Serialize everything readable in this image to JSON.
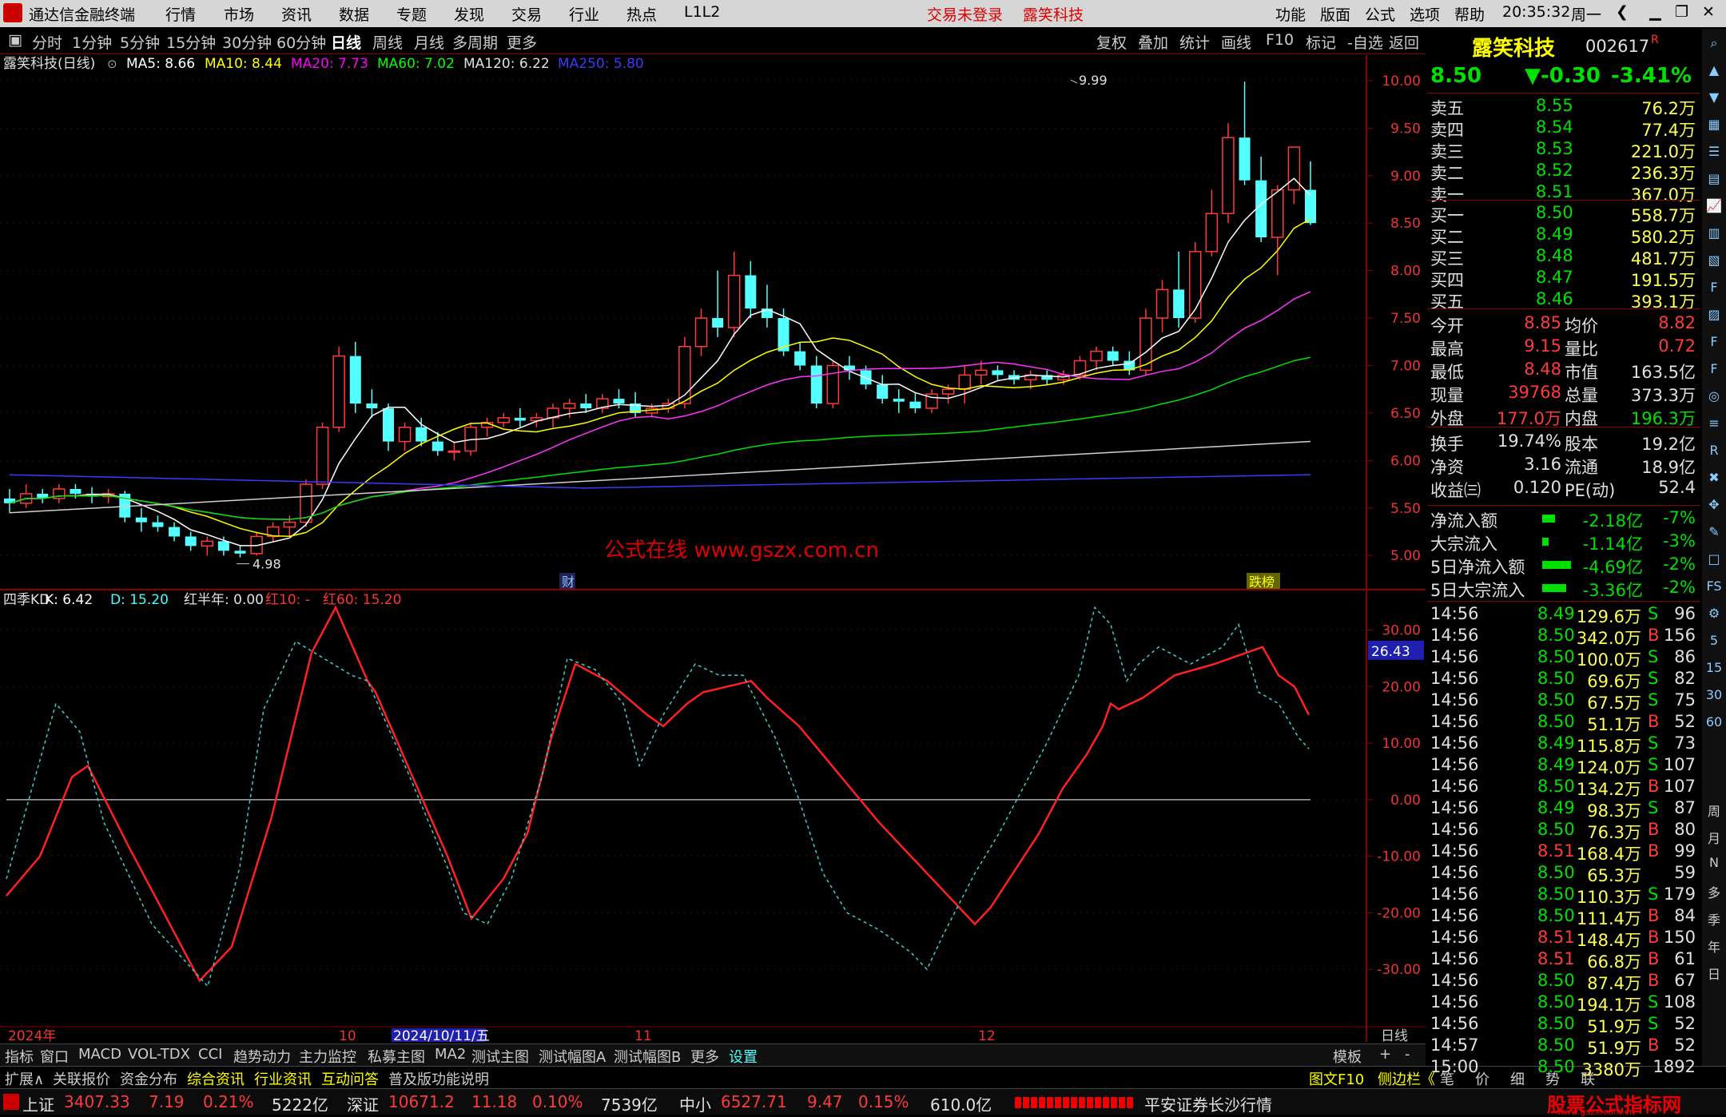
{
  "menubar": {
    "app_title": "通达信金融终端",
    "menus": [
      "行情",
      "市场",
      "资讯",
      "数据",
      "专题",
      "发现",
      "交易",
      "行业",
      "热点",
      "L1L2"
    ],
    "trade_status": "交易未登录",
    "stock_name": "露笑科技",
    "right_menus": [
      "功能",
      "版面",
      "公式",
      "选项",
      "帮助"
    ],
    "clock": "20:35:32",
    "weekday": "周一"
  },
  "toolbar": {
    "periods": [
      "分时",
      "1分钟",
      "5分钟",
      "15分钟",
      "30分钟",
      "60分钟",
      "日线",
      "周线",
      "月线",
      "多周期",
      "更多"
    ],
    "active": "日线",
    "right_buttons": [
      "复权",
      "叠加",
      "统计",
      "画线",
      "F10",
      "标记",
      "-自选",
      "返回"
    ]
  },
  "main_chart": {
    "header_name": "露笑科技(日线)",
    "ma_legend": [
      {
        "label": "MA5: 8.66",
        "color": "#ffffff"
      },
      {
        "label": "MA10: 8.44",
        "color": "#ffff00"
      },
      {
        "label": "MA20: 7.73",
        "color": "#ff00ff"
      },
      {
        "label": "MA60: 7.02",
        "color": "#00ff00"
      },
      {
        "label": "MA120: 6.22",
        "color": "#e0e0e0"
      },
      {
        "label": "MA250: 5.80",
        "color": "#3a3aff"
      }
    ],
    "y_ticks": [
      "10.00",
      "9.50",
      "9.00",
      "8.50",
      "8.00",
      "7.50",
      "7.00",
      "6.50",
      "6.00",
      "5.50",
      "5.00"
    ],
    "y_range": [
      4.8,
      10.1
    ],
    "high_label": "9.99",
    "low_label": "4.98",
    "watermark": "公式在线 www.gszx.com.cn",
    "marker_cai": "财",
    "marker_diebang": "跌榜"
  },
  "indicator": {
    "header_name": "四季KD",
    "k_label": "K: 6.42",
    "d_label": "D: 15.20",
    "hong_label": "红半年: 0.00",
    "hong10_label": "红10: -",
    "hong60_label": "红60: 15.20",
    "y_ticks": [
      "30.00",
      "20.00",
      "10.00",
      "0.00",
      "-10.00",
      "-20.00",
      "-30.00"
    ],
    "y_range": [
      -40,
      37
    ],
    "current_value": "26.43"
  },
  "time_axis": {
    "labels": [
      "2024年",
      "10",
      "2024/10/11/五",
      "11",
      "12"
    ],
    "period_label": "日线"
  },
  "chart_data": {
    "type": "candlestick",
    "candles": [
      [
        5.6,
        5.7,
        5.45,
        5.55
      ],
      [
        5.55,
        5.75,
        5.5,
        5.65
      ],
      [
        5.65,
        5.7,
        5.55,
        5.6
      ],
      [
        5.6,
        5.75,
        5.55,
        5.7
      ],
      [
        5.7,
        5.75,
        5.6,
        5.65
      ],
      [
        5.65,
        5.72,
        5.55,
        5.62
      ],
      [
        5.62,
        5.7,
        5.55,
        5.65
      ],
      [
        5.65,
        5.68,
        5.35,
        5.4
      ],
      [
        5.4,
        5.5,
        5.25,
        5.35
      ],
      [
        5.35,
        5.42,
        5.25,
        5.3
      ],
      [
        5.3,
        5.35,
        5.15,
        5.2
      ],
      [
        5.2,
        5.25,
        5.05,
        5.1
      ],
      [
        5.1,
        5.2,
        5.0,
        5.15
      ],
      [
        5.15,
        5.2,
        5.0,
        5.05
      ],
      [
        5.05,
        5.1,
        4.98,
        5.02
      ],
      [
        5.02,
        5.25,
        5.0,
        5.2
      ],
      [
        5.2,
        5.35,
        5.15,
        5.3
      ],
      [
        5.3,
        5.42,
        5.2,
        5.35
      ],
      [
        5.35,
        5.8,
        5.3,
        5.75
      ],
      [
        5.75,
        6.4,
        5.7,
        6.35
      ],
      [
        6.35,
        7.2,
        6.3,
        7.1
      ],
      [
        7.1,
        7.25,
        6.5,
        6.6
      ],
      [
        6.6,
        6.75,
        6.45,
        6.55
      ],
      [
        6.55,
        6.6,
        6.1,
        6.2
      ],
      [
        6.2,
        6.4,
        6.1,
        6.35
      ],
      [
        6.35,
        6.45,
        6.15,
        6.2
      ],
      [
        6.2,
        6.3,
        6.05,
        6.1
      ],
      [
        6.1,
        6.2,
        6.0,
        6.1
      ],
      [
        6.1,
        6.4,
        6.05,
        6.35
      ],
      [
        6.35,
        6.45,
        6.25,
        6.4
      ],
      [
        6.4,
        6.5,
        6.35,
        6.45
      ],
      [
        6.45,
        6.55,
        6.35,
        6.42
      ],
      [
        6.42,
        6.5,
        6.35,
        6.45
      ],
      [
        6.45,
        6.6,
        6.35,
        6.55
      ],
      [
        6.55,
        6.65,
        6.45,
        6.6
      ],
      [
        6.6,
        6.7,
        6.5,
        6.55
      ],
      [
        6.55,
        6.7,
        6.5,
        6.65
      ],
      [
        6.65,
        6.75,
        6.55,
        6.6
      ],
      [
        6.6,
        6.72,
        6.45,
        6.5
      ],
      [
        6.5,
        6.6,
        6.45,
        6.55
      ],
      [
        6.55,
        6.65,
        6.5,
        6.6
      ],
      [
        6.6,
        7.3,
        6.55,
        7.2
      ],
      [
        7.2,
        7.6,
        7.1,
        7.5
      ],
      [
        7.5,
        8.0,
        7.3,
        7.4
      ],
      [
        7.4,
        8.2,
        7.3,
        7.95
      ],
      [
        7.95,
        8.1,
        7.5,
        7.6
      ],
      [
        7.6,
        7.85,
        7.4,
        7.5
      ],
      [
        7.5,
        7.6,
        7.1,
        7.15
      ],
      [
        7.15,
        7.25,
        6.95,
        7.0
      ],
      [
        7.0,
        7.1,
        6.55,
        6.6
      ],
      [
        6.6,
        7.05,
        6.55,
        7.0
      ],
      [
        7.0,
        7.1,
        6.85,
        6.95
      ],
      [
        6.95,
        7.0,
        6.75,
        6.8
      ],
      [
        6.8,
        6.9,
        6.6,
        6.65
      ],
      [
        6.65,
        6.75,
        6.5,
        6.62
      ],
      [
        6.62,
        6.72,
        6.5,
        6.55
      ],
      [
        6.55,
        6.75,
        6.5,
        6.7
      ],
      [
        6.7,
        6.8,
        6.6,
        6.75
      ],
      [
        6.75,
        7.0,
        6.6,
        6.9
      ],
      [
        6.9,
        7.05,
        6.8,
        6.95
      ],
      [
        6.95,
        7.0,
        6.85,
        6.9
      ],
      [
        6.9,
        6.95,
        6.8,
        6.85
      ],
      [
        6.85,
        6.95,
        6.75,
        6.9
      ],
      [
        6.9,
        6.95,
        6.8,
        6.85
      ],
      [
        6.85,
        6.95,
        6.8,
        6.9
      ],
      [
        6.9,
        7.1,
        6.85,
        7.05
      ],
      [
        7.05,
        7.2,
        6.95,
        7.15
      ],
      [
        7.15,
        7.2,
        7.0,
        7.05
      ],
      [
        7.05,
        7.15,
        6.9,
        6.95
      ],
      [
        6.95,
        7.6,
        6.9,
        7.5
      ],
      [
        7.5,
        7.9,
        7.35,
        7.8
      ],
      [
        7.8,
        8.2,
        7.4,
        7.5
      ],
      [
        7.5,
        8.3,
        7.45,
        8.2
      ],
      [
        8.2,
        8.85,
        8.15,
        8.6
      ],
      [
        8.6,
        9.55,
        8.5,
        9.4
      ],
      [
        9.4,
        9.99,
        8.9,
        8.95
      ],
      [
        8.95,
        9.2,
        8.3,
        8.35
      ],
      [
        8.35,
        8.9,
        7.95,
        8.85
      ],
      [
        8.85,
        9.3,
        8.7,
        9.3
      ],
      [
        8.85,
        9.15,
        8.48,
        8.5
      ]
    ]
  },
  "quote": {
    "name": "露笑科技",
    "code": "002617",
    "badge": "R",
    "price": "8.50",
    "change": "▼-0.30",
    "pct": "-3.41%",
    "asks": [
      [
        "卖五",
        "8.55",
        "76.2万"
      ],
      [
        "卖四",
        "8.54",
        "77.4万"
      ],
      [
        "卖三",
        "8.53",
        "221.0万"
      ],
      [
        "卖二",
        "8.52",
        "236.3万"
      ],
      [
        "卖一",
        "8.51",
        "367.0万"
      ]
    ],
    "bids": [
      [
        "买一",
        "8.50",
        "558.7万"
      ],
      [
        "买二",
        "8.49",
        "580.2万"
      ],
      [
        "买三",
        "8.48",
        "481.7万"
      ],
      [
        "买四",
        "8.47",
        "191.5万"
      ],
      [
        "买五",
        "8.46",
        "393.1万"
      ]
    ],
    "stats": [
      [
        "今开",
        "8.85",
        "均价",
        "8.82"
      ],
      [
        "最高",
        "9.15",
        "量比",
        "0.72"
      ],
      [
        "最低",
        "8.48",
        "市值",
        "163.5亿"
      ],
      [
        "现量",
        "39768",
        "总量",
        "373.3万"
      ],
      [
        "外盘",
        "177.0万",
        "内盘",
        "196.3万"
      ]
    ],
    "stats2": [
      [
        "换手",
        "19.74%",
        "股本",
        "19.2亿"
      ],
      [
        "净资",
        "3.16",
        "流通",
        "18.9亿"
      ],
      [
        "收益㈢",
        "0.120",
        "PE(动)",
        "52.4"
      ]
    ],
    "flows": [
      [
        "净流入额",
        "-2.18亿",
        "-7%"
      ],
      [
        "大宗流入",
        "-1.14亿",
        "-3%"
      ],
      [
        "5日净流入额",
        "-4.69亿",
        "-2%"
      ],
      [
        "5日大宗流入",
        "-3.36亿",
        "-2%"
      ]
    ],
    "ticks": [
      [
        "14:56",
        "8.49",
        "129.6万",
        "S",
        "96"
      ],
      [
        "14:56",
        "8.50",
        "342.0万",
        "B",
        "156"
      ],
      [
        "14:56",
        "8.50",
        "100.0万",
        "S",
        "86"
      ],
      [
        "14:56",
        "8.50",
        "69.6万",
        "S",
        "82"
      ],
      [
        "14:56",
        "8.50",
        "67.5万",
        "S",
        "75"
      ],
      [
        "14:56",
        "8.50",
        "51.1万",
        "B",
        "52"
      ],
      [
        "14:56",
        "8.49",
        "115.8万",
        "S",
        "73"
      ],
      [
        "14:56",
        "8.49",
        "124.0万",
        "S",
        "107"
      ],
      [
        "14:56",
        "8.50",
        "134.2万",
        "B",
        "107"
      ],
      [
        "14:56",
        "8.49",
        "98.3万",
        "S",
        "87"
      ],
      [
        "14:56",
        "8.50",
        "76.3万",
        "B",
        "80"
      ],
      [
        "14:56",
        "8.51",
        "168.4万",
        "B",
        "99"
      ],
      [
        "14:56",
        "8.50",
        "65.3万",
        "",
        "59"
      ],
      [
        "14:56",
        "8.50",
        "110.3万",
        "S",
        "179"
      ],
      [
        "14:56",
        "8.50",
        "111.4万",
        "B",
        "84"
      ],
      [
        "14:56",
        "8.51",
        "148.4万",
        "B",
        "150"
      ],
      [
        "14:56",
        "8.51",
        "66.8万",
        "B",
        "61"
      ],
      [
        "14:56",
        "8.50",
        "87.4万",
        "B",
        "67"
      ],
      [
        "14:56",
        "8.50",
        "194.1万",
        "S",
        "108"
      ],
      [
        "14:56",
        "8.50",
        "51.9万",
        "S",
        "52"
      ],
      [
        "14:57",
        "8.50",
        "51.9万",
        "B",
        "52"
      ],
      [
        "15:00",
        "8.50",
        "3380万",
        "",
        "1892"
      ]
    ]
  },
  "bottom_tabs": [
    "指标",
    "窗口",
    "MACD",
    "VOL-TDX",
    "CCI",
    "趋势动力",
    "主力监控",
    "私募主图",
    "MA2",
    "测试主图",
    "测试幅图A",
    "测试幅图B",
    "更多",
    "设置"
  ],
  "bottom_right": [
    "模板",
    "+",
    "-"
  ],
  "sub_tabs": [
    "扩展∧",
    "关联报价",
    "资金分布",
    "综合资讯",
    "行业资讯",
    "互动问答",
    "普及版功能说明"
  ],
  "sub_right": [
    "图文F10",
    "侧边栏《",
    "笔",
    "价",
    "细",
    "势",
    "联"
  ],
  "status": {
    "sh_label": "上证",
    "sh_val": "3407.33",
    "sh_chg": "7.19",
    "sh_pct": "0.21%",
    "sh_amt": "5222亿",
    "sz_label": "深证",
    "sz_val": "10671.2",
    "sz_chg": "11.18",
    "sz_pct": "0.10%",
    "sz_amt": "7539亿",
    "zx_label": "中小",
    "zx_val": "6527.71",
    "zx_chg": "9.47",
    "zx_pct": "0.15%",
    "zx_amt": "610.0亿",
    "broker": "平安证券长沙行情",
    "site": "股票公式指标网",
    "site_url": "www.gszx.com.cn"
  },
  "right_icons": [
    "周",
    "月",
    "N",
    "多",
    "季",
    "年",
    "日"
  ]
}
